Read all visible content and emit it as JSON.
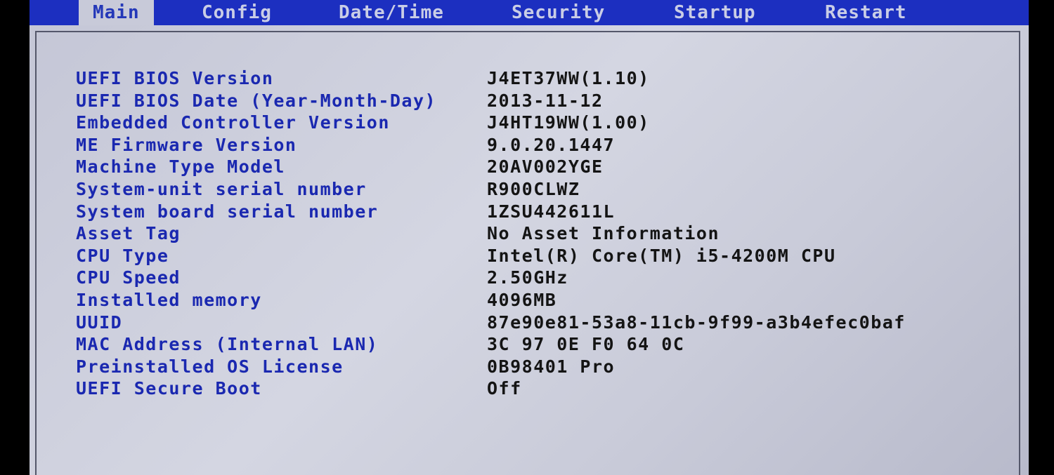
{
  "menu": {
    "tabs": [
      {
        "label": "Main",
        "active": true
      },
      {
        "label": "Config",
        "active": false
      },
      {
        "label": "Date/Time",
        "active": false
      },
      {
        "label": "Security",
        "active": false
      },
      {
        "label": "Startup",
        "active": false
      },
      {
        "label": "Restart",
        "active": false
      }
    ]
  },
  "info": {
    "rows": [
      {
        "label": "UEFI BIOS Version",
        "value": "J4ET37WW(1.10)"
      },
      {
        "label": "UEFI BIOS Date (Year-Month-Day)",
        "value": "2013-11-12"
      },
      {
        "label": "Embedded Controller Version",
        "value": "J4HT19WW(1.00)"
      },
      {
        "label": "ME Firmware Version",
        "value": "9.0.20.1447"
      },
      {
        "label": "Machine Type Model",
        "value": "20AV002YGE"
      },
      {
        "label": "System-unit serial number",
        "value": "R900CLWZ"
      },
      {
        "label": "System board serial number",
        "value": "1ZSU442611L"
      },
      {
        "label": "Asset Tag",
        "value": "No Asset Information"
      },
      {
        "label": "CPU Type",
        "value": "Intel(R) Core(TM) i5-4200M CPU"
      },
      {
        "label": "CPU Speed",
        "value": "2.50GHz"
      },
      {
        "label": "Installed memory",
        "value": "4096MB"
      },
      {
        "label": "UUID",
        "value": "87e90e81-53a8-11cb-9f99-a3b4efec0baf"
      },
      {
        "label": "MAC Address (Internal LAN)",
        "value": "3C 97 0E F0 64 0C"
      },
      {
        "label": "Preinstalled OS License",
        "value": "0B98401 Pro"
      },
      {
        "label": "UEFI Secure Boot",
        "value": "Off"
      }
    ]
  },
  "colors": {
    "menu_bar": "#1c2fc0",
    "label_text": "#1a28b0",
    "value_text": "#141414",
    "background": "#c8cad9"
  }
}
